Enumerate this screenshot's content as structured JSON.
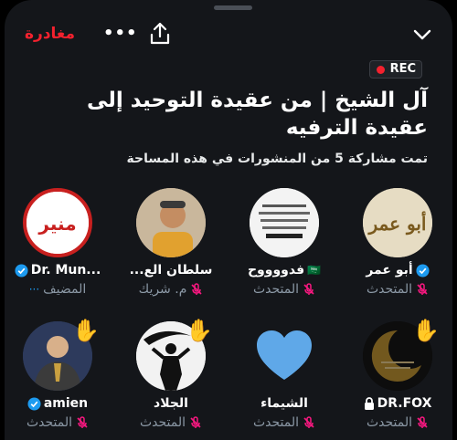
{
  "topbar": {
    "leave_label": "مغادرة",
    "more_label": "•••",
    "share_icon": "share-icon",
    "collapse_icon": "chevron-down-icon"
  },
  "rec_label": "REC",
  "space": {
    "title": "آل الشيخ | من عقيدة التوحيد إلى عقيدة الترفيه",
    "subtitle": "تمت مشاركة 5 من المنشورات في هذه المساحة"
  },
  "avatars": {
    "munir_text": "منير",
    "abu_omar_text": "أبو عمر"
  },
  "participants": [
    {
      "name": "أبو عمر",
      "role": "المتحدث",
      "verified": true
    },
    {
      "name": "فدووووح",
      "role": "المتحدث",
      "flag": "🇸🇦"
    },
    {
      "name": "سلطان الع...",
      "role": "م. شريك"
    },
    {
      "name": "Dr. Mun...",
      "role": "المضيف",
      "verified": true
    },
    {
      "name": "DR.FOX",
      "role": "المتحدث",
      "locked": true
    },
    {
      "name": "الشيماء",
      "role": "المتحدث"
    },
    {
      "name": "الجلاد",
      "role": "المتحدث"
    },
    {
      "name": "amien",
      "role": "المتحدث",
      "verified": true
    }
  ],
  "colors": {
    "accent": "#f4212e",
    "verified": "#1d9bf0",
    "muted": "#8b98a5",
    "mic_off": "#f91880"
  }
}
